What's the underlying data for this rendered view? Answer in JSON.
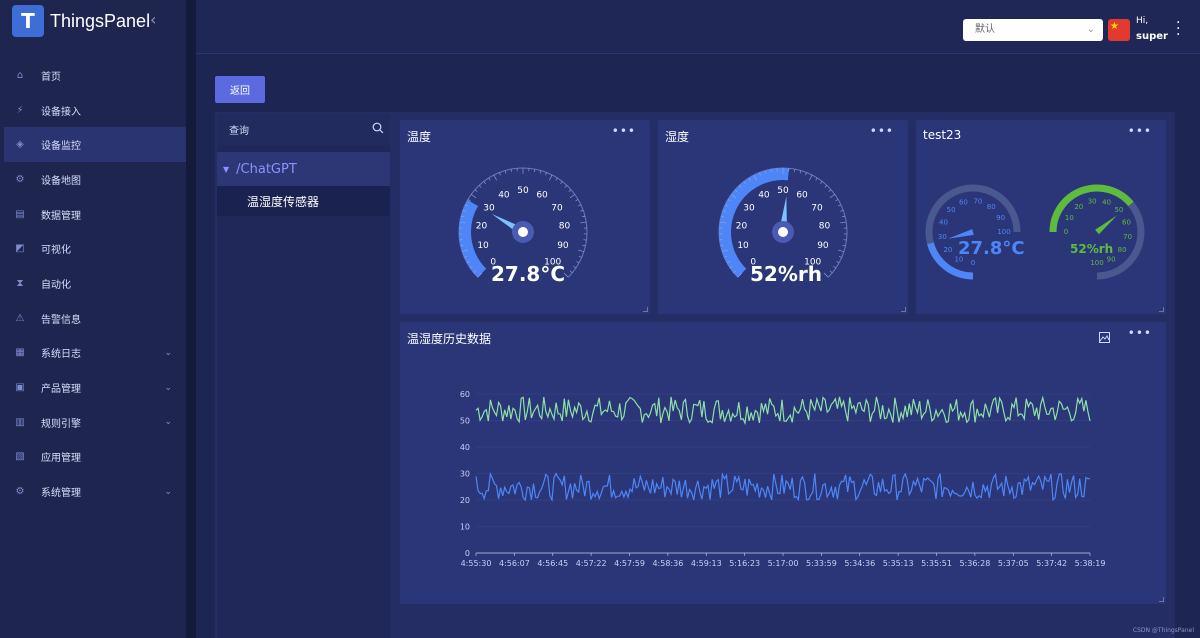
{
  "app": {
    "name": "ThingsPanel",
    "logo_letter": "T"
  },
  "sidebar": {
    "items": [
      {
        "label": "首页",
        "icon": "home-icon",
        "active": false,
        "expandable": false
      },
      {
        "label": "设备接入",
        "icon": "device-access-icon",
        "active": false,
        "expandable": false
      },
      {
        "label": "设备监控",
        "icon": "device-monitor-icon",
        "active": true,
        "expandable": false
      },
      {
        "label": "设备地图",
        "icon": "map-icon",
        "active": false,
        "expandable": false
      },
      {
        "label": "数据管理",
        "icon": "data-icon",
        "active": false,
        "expandable": false
      },
      {
        "label": "可视化",
        "icon": "visual-icon",
        "active": false,
        "expandable": false
      },
      {
        "label": "自动化",
        "icon": "automation-icon",
        "active": false,
        "expandable": false
      },
      {
        "label": "告警信息",
        "icon": "alert-icon",
        "active": false,
        "expandable": false
      },
      {
        "label": "系统日志",
        "icon": "log-icon",
        "active": false,
        "expandable": true
      },
      {
        "label": "产品管理",
        "icon": "product-icon",
        "active": false,
        "expandable": true
      },
      {
        "label": "规则引擎",
        "icon": "rule-icon",
        "active": false,
        "expandable": true
      },
      {
        "label": "应用管理",
        "icon": "app-icon",
        "active": false,
        "expandable": false
      },
      {
        "label": "系统管理",
        "icon": "settings-icon",
        "active": false,
        "expandable": true
      }
    ]
  },
  "header": {
    "select_value": "默认",
    "greeting": "Hi,",
    "username": "super"
  },
  "back_label": "返回",
  "tree": {
    "search_label": "查询",
    "group": "/ChatGPT",
    "leaf": "温湿度传感器"
  },
  "cards": {
    "temp": {
      "title": "温度",
      "value": "27.8°C",
      "reading": 27.8,
      "ticks": [
        "0",
        "10",
        "20",
        "30",
        "40",
        "50",
        "60",
        "70",
        "80",
        "90",
        "100"
      ]
    },
    "humidity": {
      "title": "湿度",
      "value": "52%rh",
      "reading": 52,
      "ticks": [
        "0",
        "10",
        "20",
        "30",
        "40",
        "50",
        "60",
        "70",
        "80",
        "90",
        "100"
      ]
    },
    "test": {
      "title": "test23",
      "temp_value": "27.8°C",
      "temp_reading": 27.8,
      "hum_value": "52%rh",
      "hum_reading": 52,
      "left_ticks": [
        "0",
        "10",
        "20",
        "30",
        "40",
        "50",
        "60",
        "70",
        "80",
        "90",
        "100"
      ],
      "right_ticks": [
        "0",
        "10",
        "20",
        "30",
        "40",
        "50",
        "60",
        "70",
        "80",
        "90",
        "100"
      ]
    },
    "history": {
      "title": "温湿度历史数据"
    }
  },
  "colors": {
    "blue": "#4f86f7",
    "green": "#8ee0a8",
    "gauge_blue": "#4f86f7",
    "gauge_green": "#5fbb3d"
  },
  "chart_data": {
    "type": "line",
    "title": "",
    "x": [
      "4:55:30",
      "4:56:07",
      "4:56:45",
      "4:57:22",
      "4:57:59",
      "4:58:36",
      "4:59:13",
      "5:16:23",
      "5:17:00",
      "5:33:59",
      "5:34:36",
      "5:35:13",
      "5:35:51",
      "5:36:28",
      "5:37:05",
      "5:37:42",
      "5:38:19"
    ],
    "ylim": [
      0,
      60
    ],
    "yticks": [
      0,
      10,
      20,
      30,
      40,
      50,
      60
    ],
    "grid": true,
    "series": [
      {
        "name": "",
        "color": "#8ee0a8",
        "mean": 54,
        "amplitude": 5
      },
      {
        "name": "",
        "color": "#4f86f7",
        "mean": 25,
        "amplitude": 5
      }
    ]
  },
  "watermark": "CSDN @ThingsPanel"
}
